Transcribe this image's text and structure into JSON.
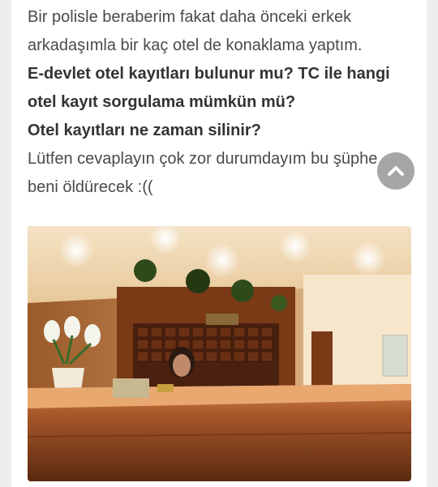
{
  "article": {
    "paragraph_1": "Bir polisle beraberim fakat daha önceki erkek arkadaşımla bir kaç otel de konaklama yaptım.",
    "question_1": "E-devlet otel kayıtları bulunur mu? TC ile hangi otel kayıt sorgulama mümkün mü?",
    "question_2": "Otel kayıtları ne zaman silinir?",
    "paragraph_2": "Lütfen cevaplayın çok zor durumdayım bu şüphe beni öldürecek :(("
  },
  "scroll_top_button": {
    "icon": "chevron-up-icon",
    "color": "#969696"
  },
  "image": {
    "subject": "hotel-reception-photo"
  }
}
